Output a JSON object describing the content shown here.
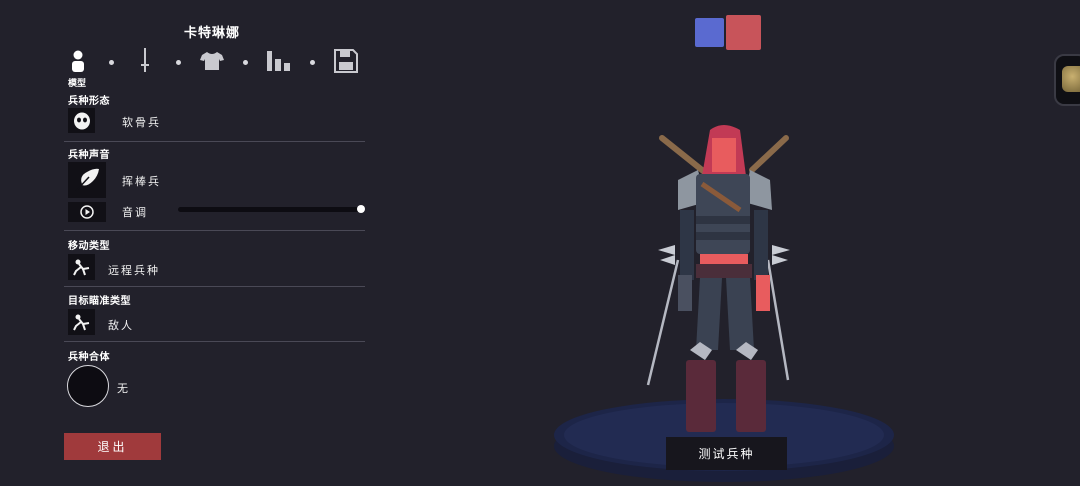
{
  "unit_name": "卡特琳娜",
  "tabs": {
    "active_label": "模型",
    "items": [
      "model-icon",
      "sword-icon",
      "shirt-icon",
      "stats-icon",
      "save-icon"
    ]
  },
  "sections": {
    "body_type": {
      "label": "兵种形态",
      "value": "软骨兵",
      "icon": "face-icon"
    },
    "voice": {
      "label": "兵种声音",
      "value": "挥棒兵",
      "icon": "feather-icon",
      "pitch_label": "音调",
      "pitch_value": 1.0
    },
    "movement": {
      "label": "移动类型",
      "value": "远程兵种",
      "icon": "pose-icon"
    },
    "targeting": {
      "label": "目标瞄准类型",
      "value": "敌人",
      "icon": "pose-icon"
    },
    "mount": {
      "label": "兵种合体",
      "value": "无"
    }
  },
  "buttons": {
    "exit": "退出",
    "test_unit": "测试兵种"
  },
  "team_colors": [
    "#5a6ad0",
    "#c8545a"
  ],
  "colors": {
    "background": "#22212b",
    "exit_button": "#a03a3c",
    "platform": "#1d2548"
  }
}
